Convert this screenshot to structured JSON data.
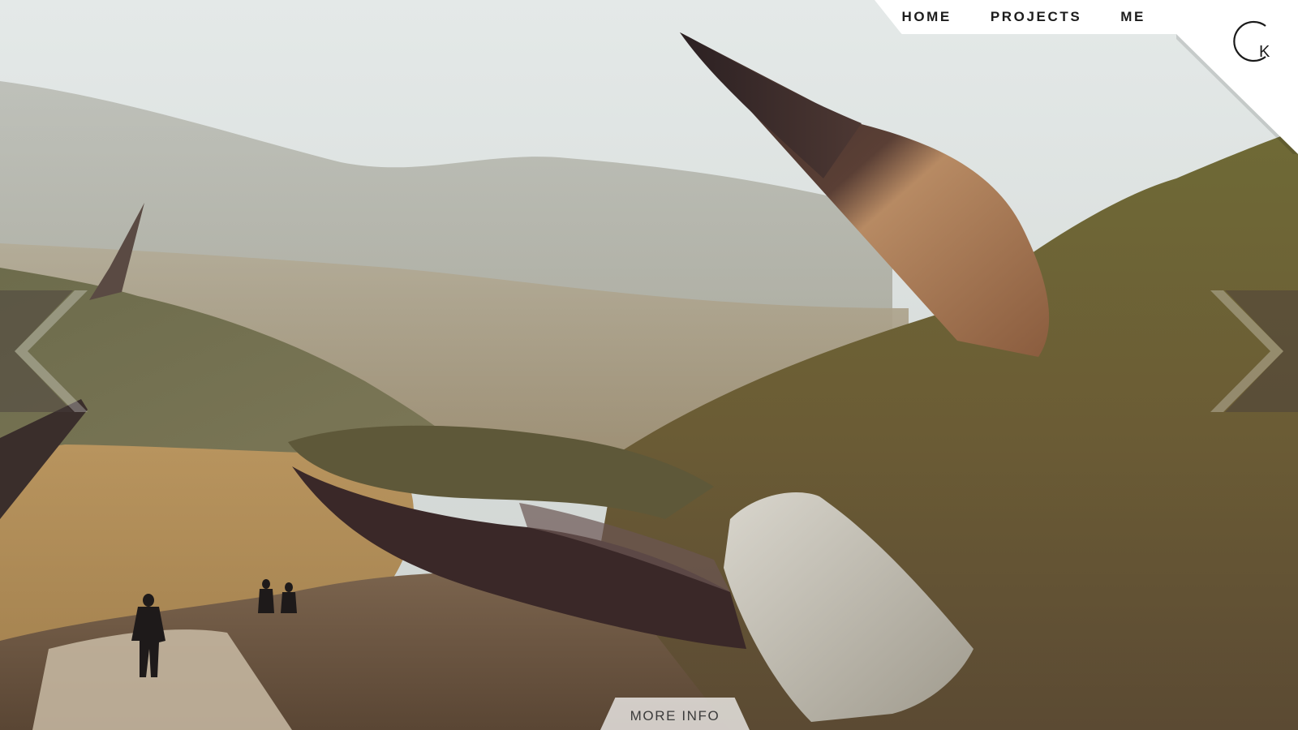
{
  "nav": {
    "items": [
      {
        "label": "HOME"
      },
      {
        "label": "PROJECTS"
      },
      {
        "label": "ME"
      }
    ]
  },
  "logo": {
    "letter_large": "C",
    "letter_small": "K"
  },
  "slider": {
    "prev_icon": "chevron-left-icon",
    "next_icon": "chevron-right-icon"
  },
  "more_info": {
    "label": "MORE INFO"
  },
  "colors": {
    "nav_background": "#ffffff",
    "nav_text": "#1c1c1c",
    "more_info_text": "#3b3b3b"
  }
}
